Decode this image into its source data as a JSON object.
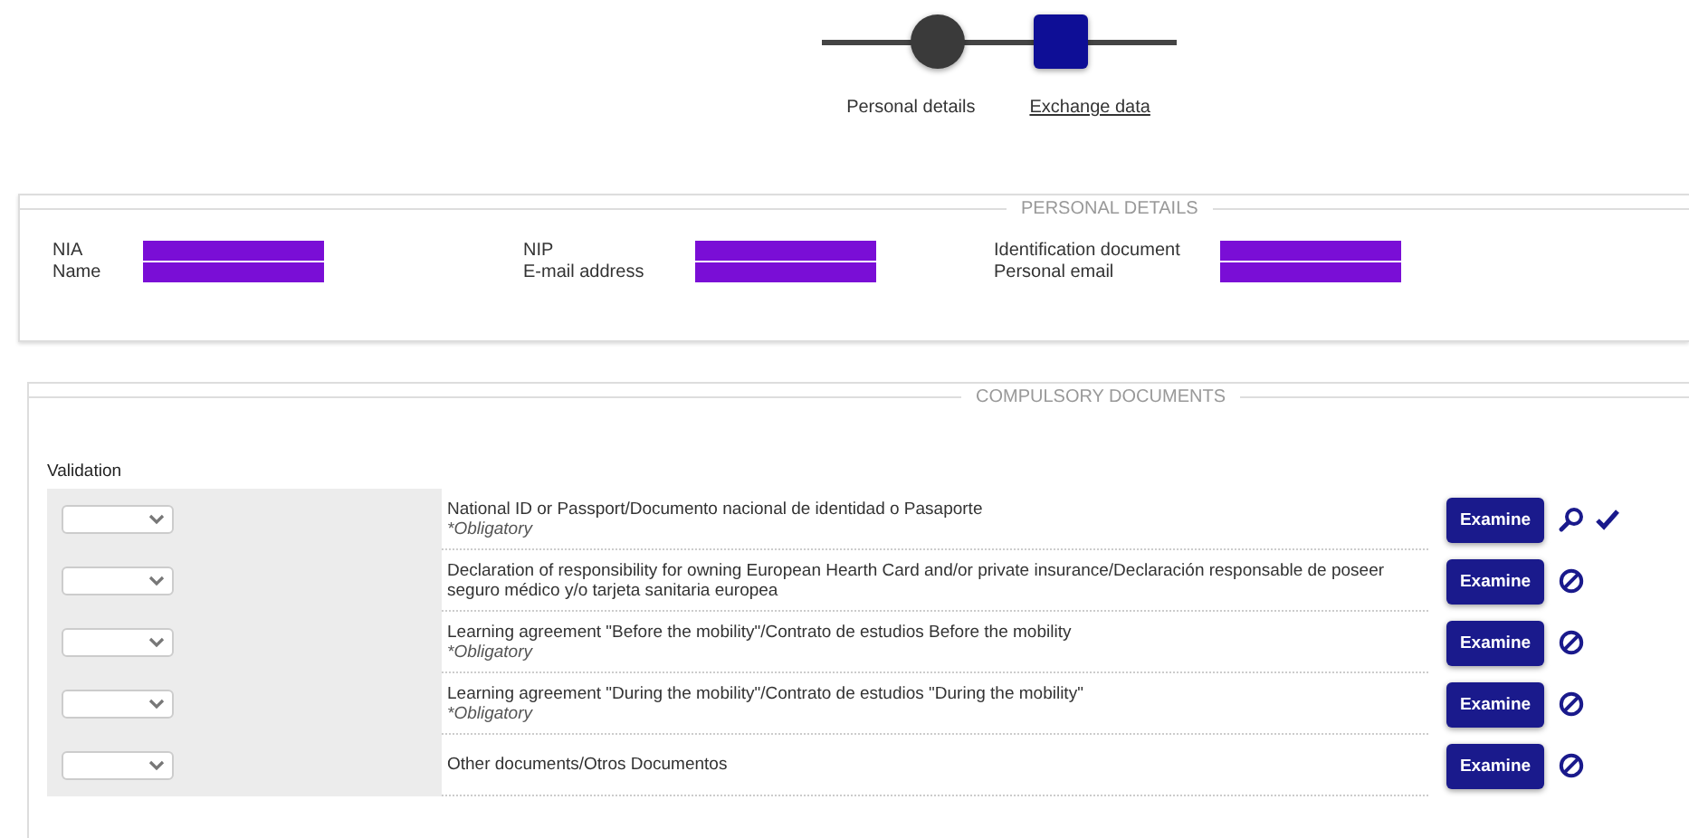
{
  "stepper": {
    "steps": [
      {
        "label": "Personal details",
        "kind": "circle",
        "selected": false
      },
      {
        "label": "Exchange data",
        "kind": "square",
        "selected": true
      }
    ]
  },
  "personal_details": {
    "title": "PERSONAL DETAILS",
    "fields": [
      {
        "label": "NIA",
        "redacted": true
      },
      {
        "label": "Name",
        "redacted": true
      },
      {
        "label": "NIP",
        "redacted": true
      },
      {
        "label": "E-mail address",
        "redacted": true
      },
      {
        "label": "Identification document",
        "redacted": true
      },
      {
        "label": "Personal email",
        "redacted": true
      }
    ]
  },
  "compulsory_documents": {
    "title": "COMPULSORY DOCUMENTS",
    "validation_label": "Validation",
    "rows": [
      {
        "description": "National ID or Passport/Documento nacional de identidad o Pasaporte",
        "note": "*Obligatory",
        "button_label": "Examine",
        "kind": "uploaded"
      },
      {
        "description": "Declaration of responsibility for owning European Hearth Card and/or private insurance/Declaración responsable de poseer seguro médico y/o tarjeta sanitaria europea",
        "button_label": "Examine",
        "kind": "missing"
      },
      {
        "description": "Learning agreement \"Before the mobility\"/Contrato de estudios Before the mobility",
        "note": "*Obligatory",
        "button_label": "Examine",
        "kind": "missing"
      },
      {
        "description": "Learning agreement \"During the mobility\"/Contrato de estudios \"During the mobility\"",
        "note": "*Obligatory",
        "button_label": "Examine",
        "kind": "missing"
      },
      {
        "description": "Other documents/Otros Documentos",
        "button_label": "Examine",
        "kind": "missing"
      }
    ]
  }
}
